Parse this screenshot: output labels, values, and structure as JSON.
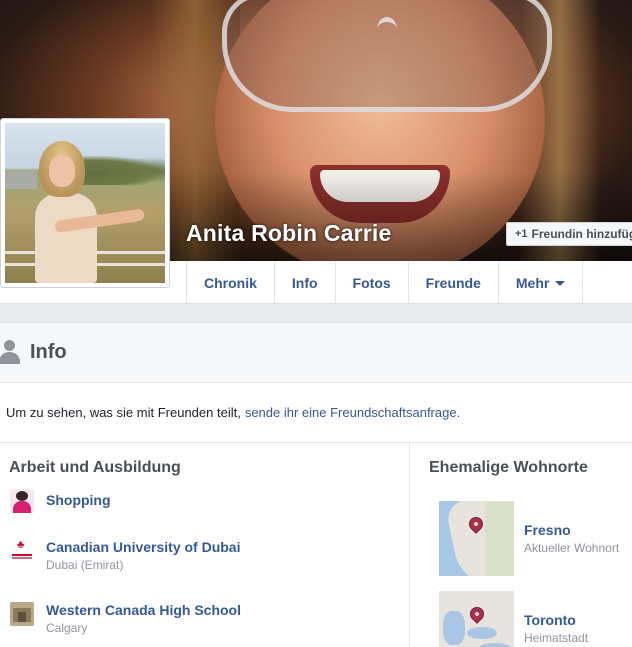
{
  "profile": {
    "name": "Anita Robin Carrie",
    "add_friend_label": "Freundin hinzufügen",
    "add_friend_icon": "+1"
  },
  "nav": {
    "tabs": [
      "Chronik",
      "Info",
      "Fotos",
      "Freunde",
      "Mehr"
    ]
  },
  "info": {
    "title": "Info",
    "friend_note_text": "Um zu sehen, was sie mit Freunden teilt,",
    "friend_note_link": "sende ihr eine Freundschaftsanfrage."
  },
  "work": {
    "title": "Arbeit und Ausbildung",
    "items": [
      {
        "name": "Shopping",
        "sub": ""
      },
      {
        "name": "Canadian University of Dubai",
        "sub": "Dubai (Emirat)"
      },
      {
        "name": "Western Canada High School",
        "sub": "Calgary"
      }
    ]
  },
  "places": {
    "title": "Ehemalige Wohnorte",
    "items": [
      {
        "name": "Fresno",
        "sub": "Aktueller Wohnort"
      },
      {
        "name": "Toronto",
        "sub": "Heimatstadt"
      }
    ]
  },
  "colors": {
    "link": "#365899",
    "muted": "#90949c",
    "heading": "#4b4f56",
    "map_pin": "#a8304a"
  }
}
